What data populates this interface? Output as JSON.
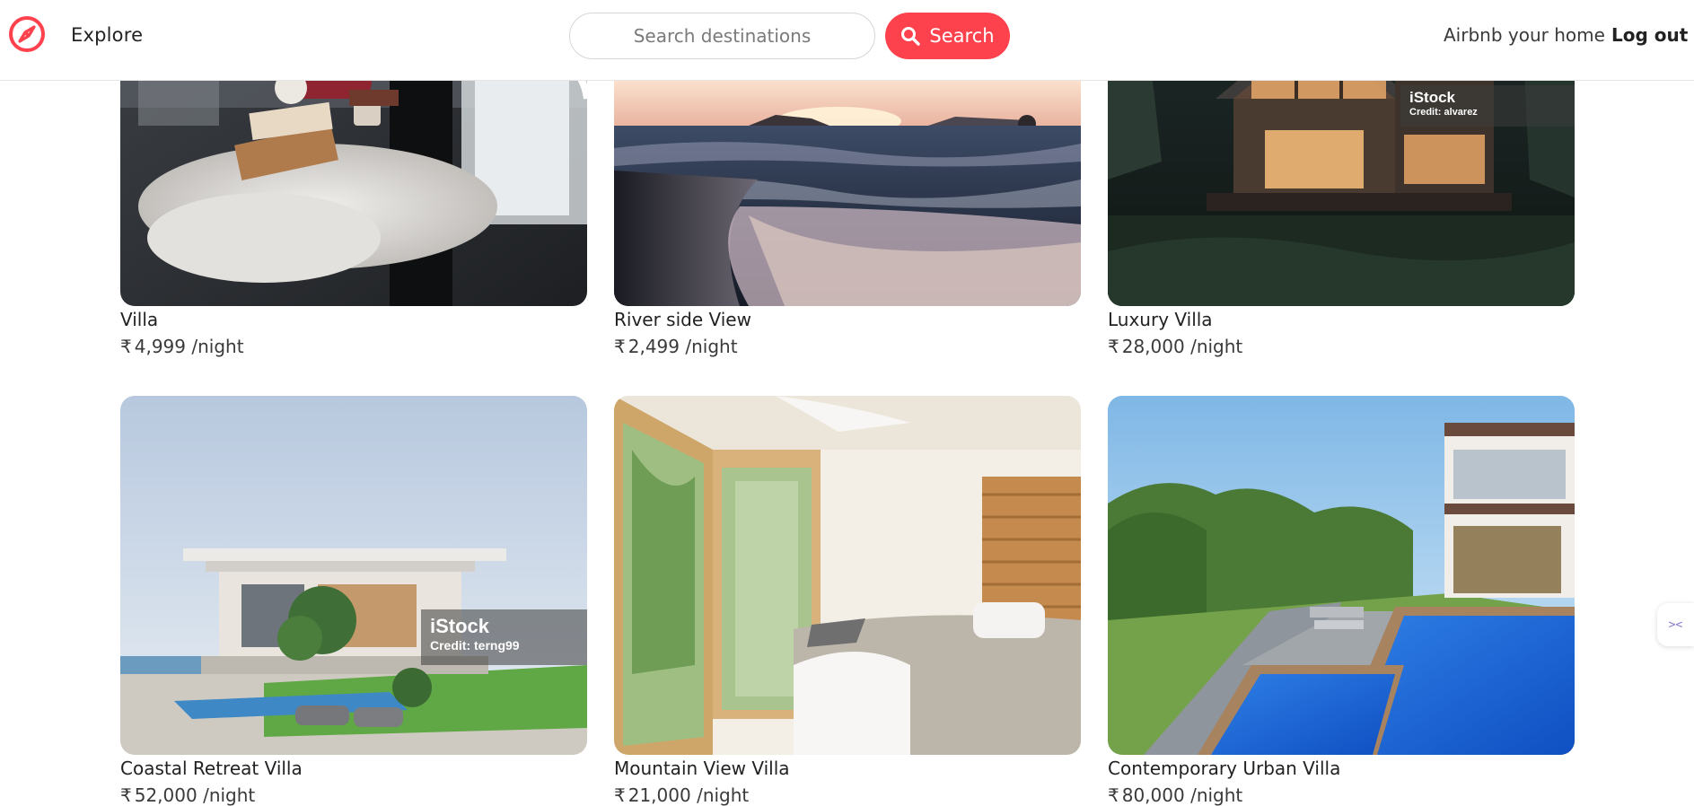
{
  "header": {
    "explore_label": "Explore",
    "search_placeholder": "Search destinations",
    "search_value": "",
    "search_button_label": "Search",
    "host_link_label": "Airbnb your home",
    "logout_label": "Log out"
  },
  "icons": {
    "logo": "compass-icon",
    "search": "search-icon",
    "side_widget": "collapse-arrows-icon"
  },
  "colors": {
    "brand": "#fe424d",
    "text": "#222222"
  },
  "currency_symbol": "₹",
  "listings": [
    {
      "title": "Villa",
      "price": "4,999",
      "unit": "/night",
      "image": "cozy-window-seat-photo",
      "watermark": null
    },
    {
      "title": "River side View",
      "price": "2,499",
      "unit": "/night",
      "image": "sunset-beach-photo",
      "watermark": null
    },
    {
      "title": "Luxury Villa",
      "price": "28,000",
      "unit": "/night",
      "image": "modern-cabin-forest-photo",
      "watermark": {
        "brand": "iStock",
        "credit": "Credit: alvarez"
      }
    },
    {
      "title": "Coastal Retreat Villa",
      "price": "52,000",
      "unit": "/night",
      "image": "coastal-modern-villa-photo",
      "watermark": {
        "brand": "iStock",
        "credit": "Credit: terng99"
      }
    },
    {
      "title": "Mountain View Villa",
      "price": "21,000",
      "unit": "/night",
      "image": "bright-bedroom-photo",
      "watermark": null
    },
    {
      "title": "Contemporary Urban Villa",
      "price": "80,000",
      "unit": "/night",
      "image": "villa-pool-garden-photo",
      "watermark": null
    }
  ],
  "side_widget_glyph": "><"
}
